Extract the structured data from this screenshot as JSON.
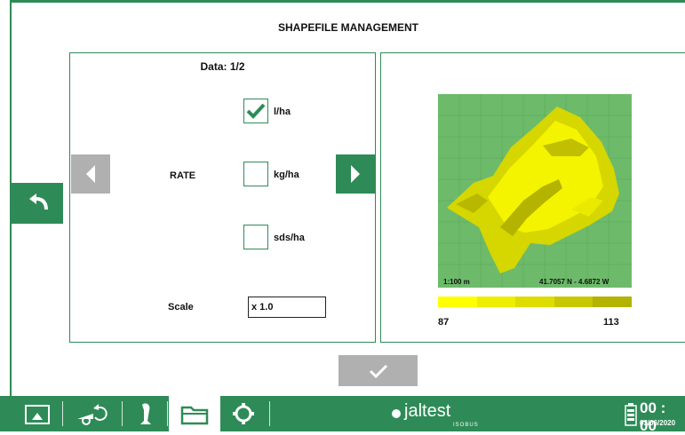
{
  "title": "SHAPEFILE MANAGEMENT",
  "left_panel": {
    "data_label": "Data: 1/2",
    "rate_label": "RATE",
    "options": [
      {
        "label": "l/ha",
        "checked": true
      },
      {
        "label": "kg/ha",
        "checked": false
      },
      {
        "label": "sds/ha",
        "checked": false
      }
    ],
    "scale_label": "Scale",
    "scale_value": "x 1.0"
  },
  "map": {
    "scale_text": "1:100 m",
    "coords_text": "41.7057 N  -  4.6872 W",
    "legend_min": "87",
    "legend_max": "113",
    "legend_colors": [
      "#ffff00",
      "#eeee00",
      "#dddd00",
      "#c8c800",
      "#b3b300"
    ]
  },
  "bottom_bar": {
    "brand": "jaltest",
    "brand_sub": "ISOBUS",
    "time": "00 : 00",
    "date": "03/06/2020"
  },
  "colors": {
    "accent": "#2e8b57",
    "nav_disabled": "#b0b0b0"
  }
}
